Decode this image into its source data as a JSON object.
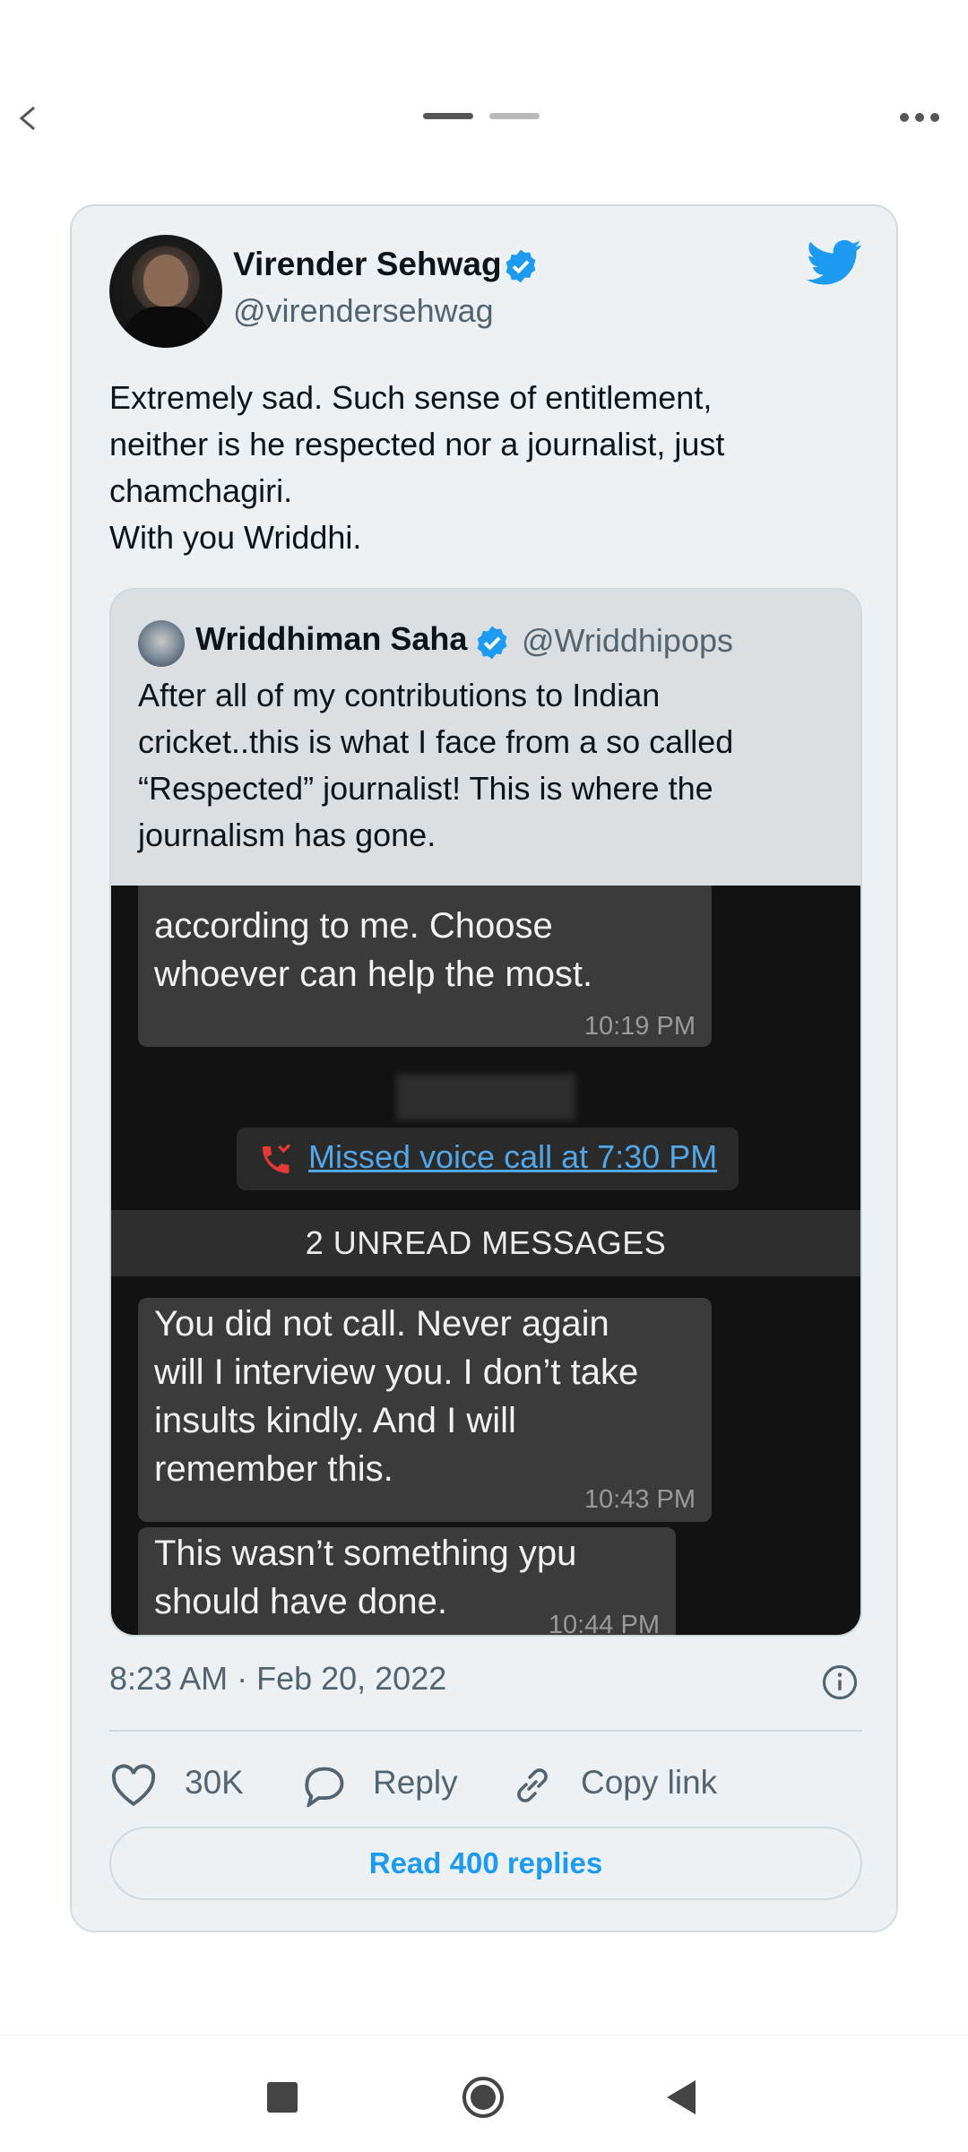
{
  "tweet": {
    "author_name": "Virender Sehwag",
    "author_handle": "@virendersehwag",
    "text_lines": [
      "Extremely sad. Such sense of entitlement,",
      "neither is he respected nor a journalist, just",
      "chamchagiri.",
      "With you Wriddhi."
    ],
    "timestamp": "8:23 AM · Feb 20, 2022",
    "likes": "30K",
    "reply_label": "Reply",
    "copy_link_label": "Copy link",
    "read_replies_label": "Read 400 replies"
  },
  "quote": {
    "author_name": "Wriddhiman Saha",
    "author_handle": "@Wriddhipops",
    "text_lines": [
      "After all of my contributions to Indian",
      "cricket..this is what I face from a so called",
      "“Respected” journalist! This is where the",
      "journalism has gone."
    ],
    "chat": {
      "msg1_lines": [
        "according to me. Choose",
        "whoever can help the most."
      ],
      "msg1_time": "10:19 PM",
      "missed_call": "Missed voice call at 7:30 PM",
      "unread": "2 UNREAD MESSAGES",
      "msg2_lines": [
        "You did not call. Never again",
        "will I interview you. I don’t take",
        "insults kindly. And I will",
        "remember this."
      ],
      "msg2_time": "10:43 PM",
      "msg3_lines": [
        "This wasn’t something ypu",
        "should have done."
      ],
      "msg3_time": "10:44 PM"
    }
  },
  "colors": {
    "accent": "#1d9bf0",
    "card_bg": "#edf1f4",
    "secondary_text": "#536471"
  },
  "icons": [
    "back-arrow-icon",
    "more-options-icon",
    "verified-badge-icon",
    "twitter-bird-icon",
    "info-icon",
    "heart-icon",
    "reply-bubble-icon",
    "link-icon",
    "nav-recent-icon",
    "nav-home-icon",
    "nav-back-icon"
  ]
}
